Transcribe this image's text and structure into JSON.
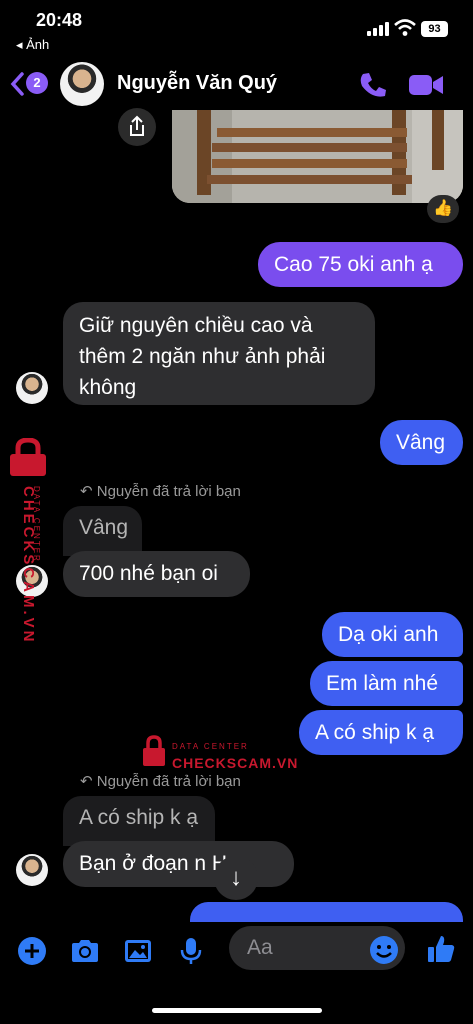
{
  "status_bar": {
    "time": "20:48",
    "back_app": "◂ Ảnh",
    "battery": "93"
  },
  "header": {
    "back_badge_count": "2",
    "contact_name": "Nguyễn Văn Quý"
  },
  "messages": {
    "out1": "Cao 75 oki anh ạ",
    "in1_line1": "Giữ nguyên chiều cao và",
    "in1_line2": "thêm 2 ngăn như ảnh phải",
    "in1_line3": "không",
    "out2": "Vâng",
    "reply_note1": "Nguyễn đã trả lời bạn",
    "quoted1": "Vâng",
    "in2": "700 nhé bạn oi",
    "out3": "Dạ oki anh",
    "out4": "Em làm nhé",
    "out5": "A có ship k ạ",
    "reply_note2": "Nguyễn đã trả lời bạn",
    "quoted2": "A có ship k ạ",
    "in3": "Bạn ở đoạn n   Hn"
  },
  "reaction": "👍",
  "watermark": {
    "main": "CHECKSCAM.VN",
    "sub": "DATA CENTER"
  },
  "composer": {
    "placeholder": "Aa"
  },
  "colors": {
    "accent": "#8a5cf6",
    "out_bubble_purple": "#7a4dee",
    "out_bubble_blue": "#3f5ff2",
    "in_bubble": "#2e2e30"
  }
}
